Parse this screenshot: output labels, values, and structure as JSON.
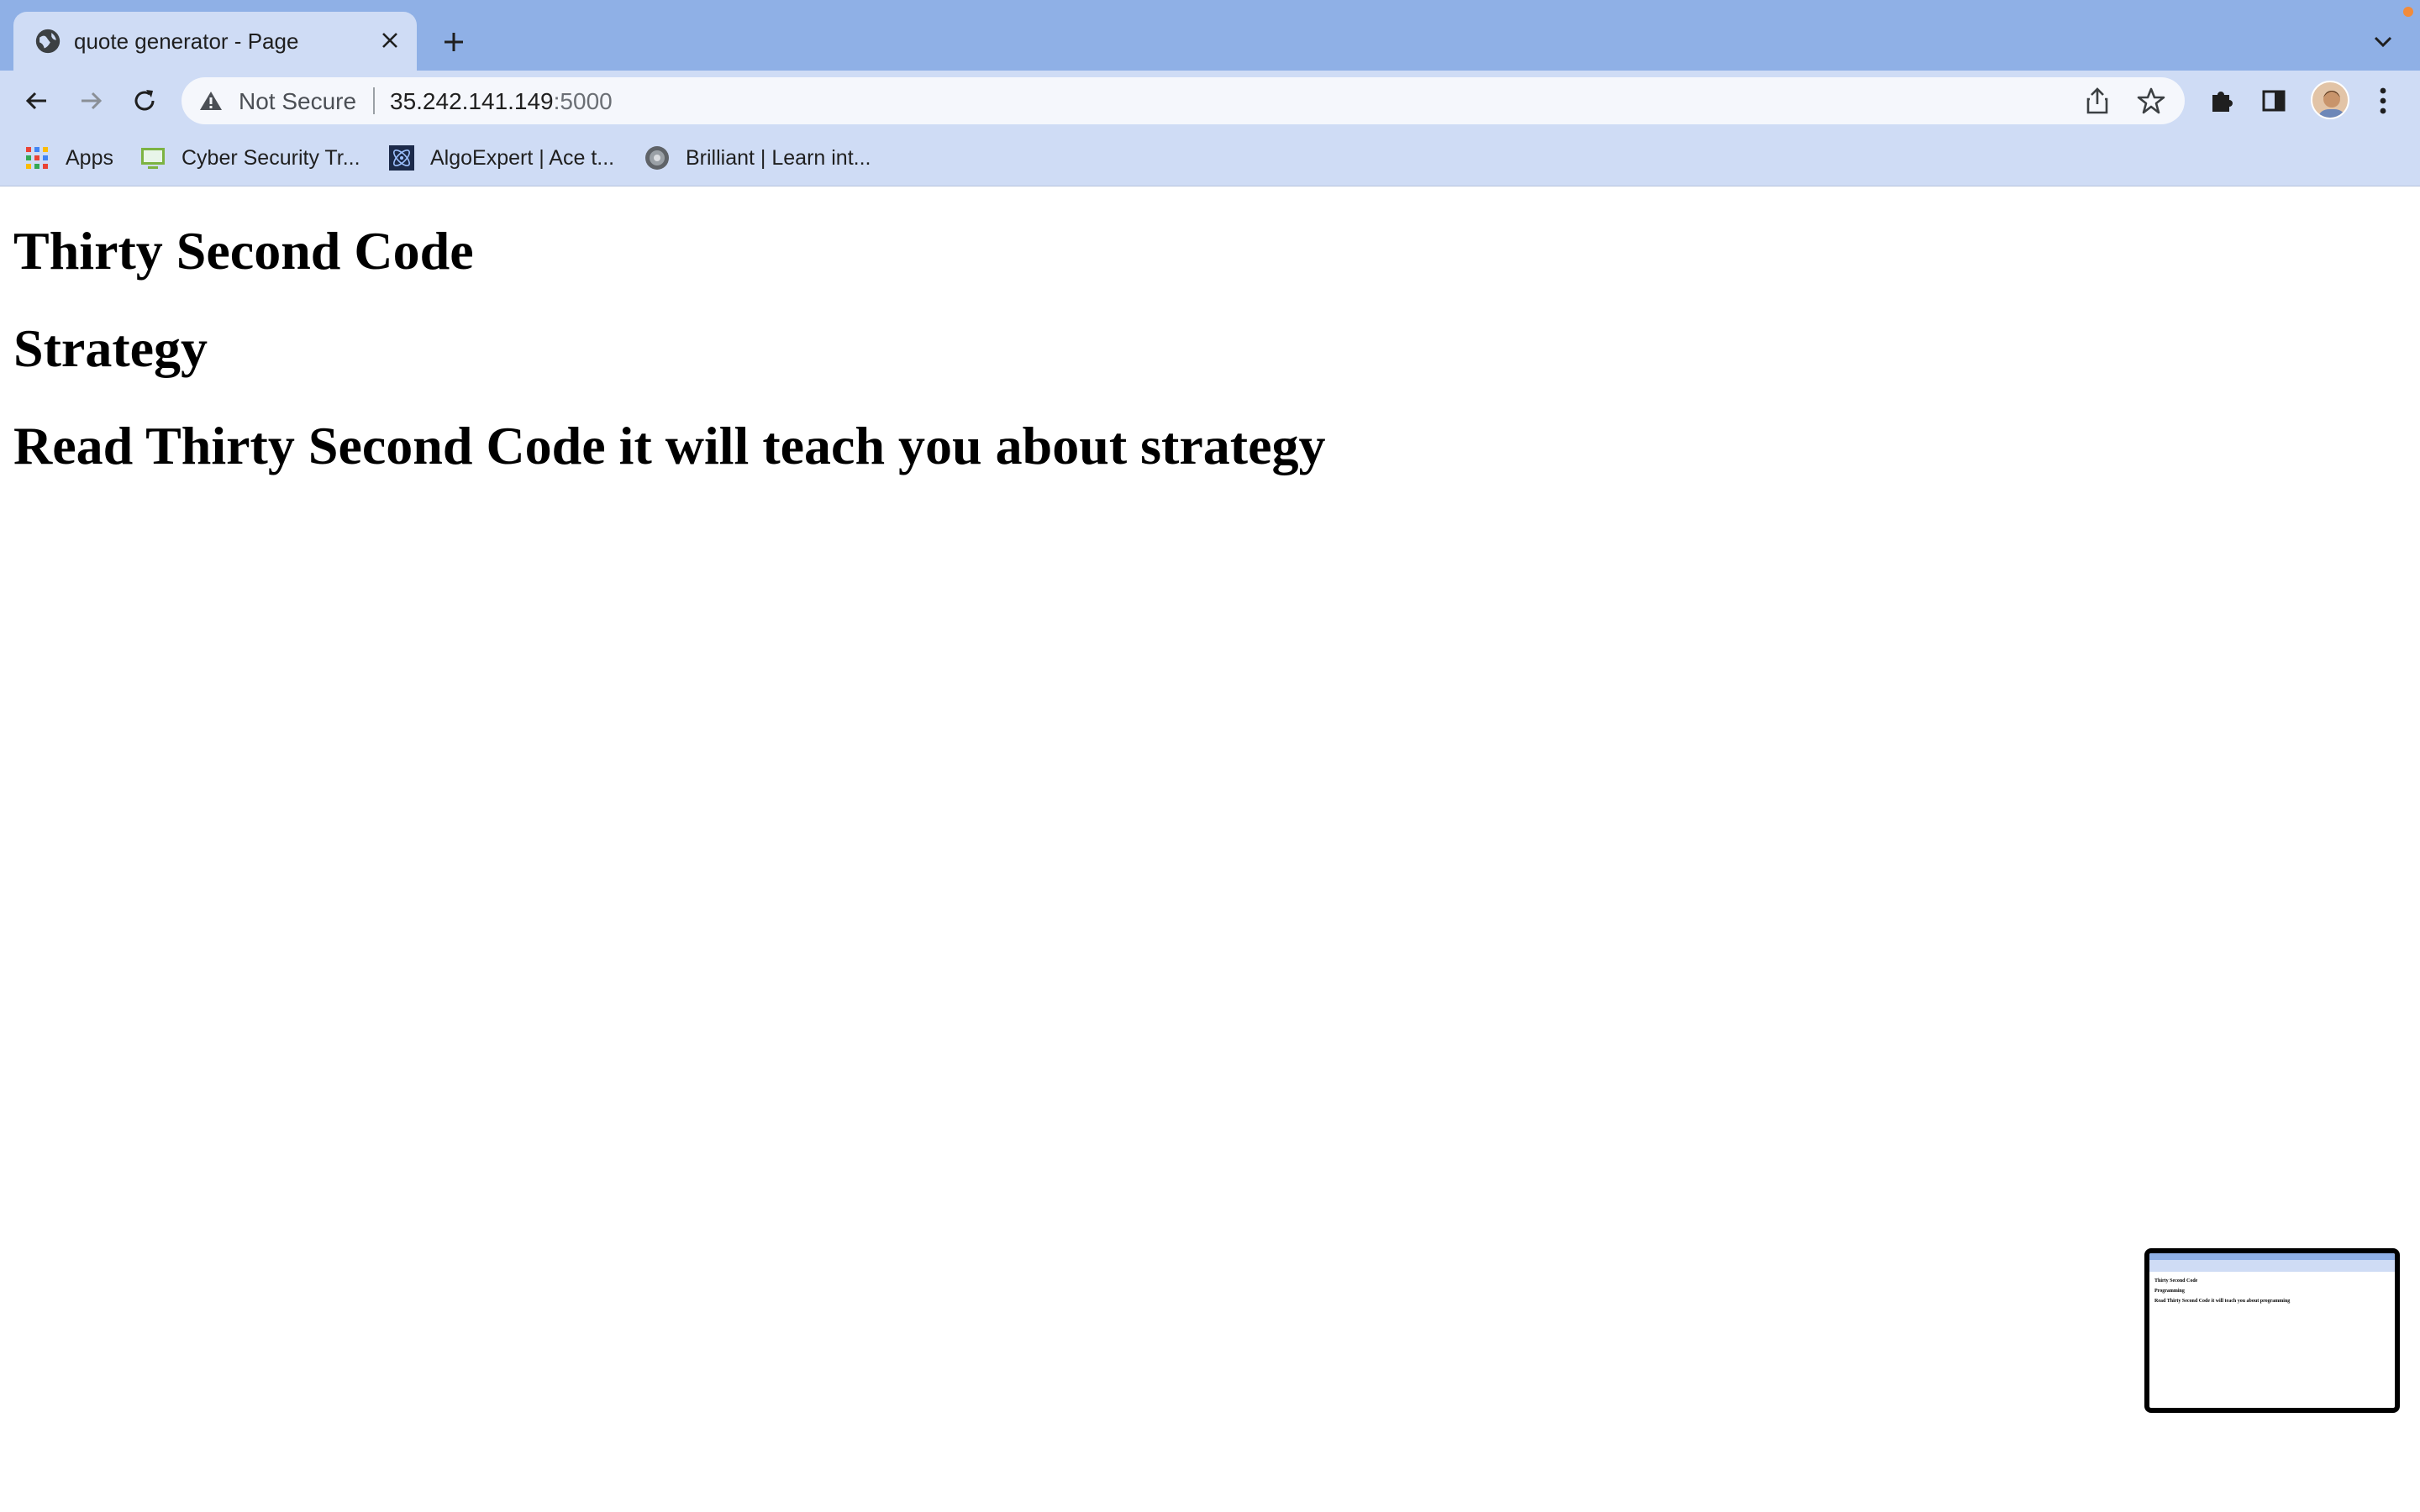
{
  "browser": {
    "tab": {
      "title": "quote generator - Page",
      "favicon": "globe-icon"
    },
    "address_bar": {
      "security_label": "Not Secure",
      "host": "35.242.141.149",
      "port": ":5000"
    },
    "bookmarks": [
      {
        "label": "Apps",
        "icon": "apps-grid-icon"
      },
      {
        "label": "Cyber Security Tr...",
        "icon": "monitor-icon"
      },
      {
        "label": "AlgoExpert | Ace t...",
        "icon": "algoexpert-icon"
      },
      {
        "label": "Brilliant | Learn int...",
        "icon": "brilliant-icon"
      }
    ],
    "colors": {
      "tabstrip": "#8fb0e6",
      "toolbar": "#cfdcf5",
      "omnibox": "#f5f7fc"
    }
  },
  "page": {
    "heading_1": "Thirty Second Code",
    "heading_2": "Strategy",
    "heading_3": "Read Thirty Second Code it will teach you about strategy"
  },
  "thumbnail": {
    "line_1": "Thirty Second Code",
    "line_2": "Programming",
    "line_3": "Read Thirty Second Code it will teach you about programming"
  }
}
